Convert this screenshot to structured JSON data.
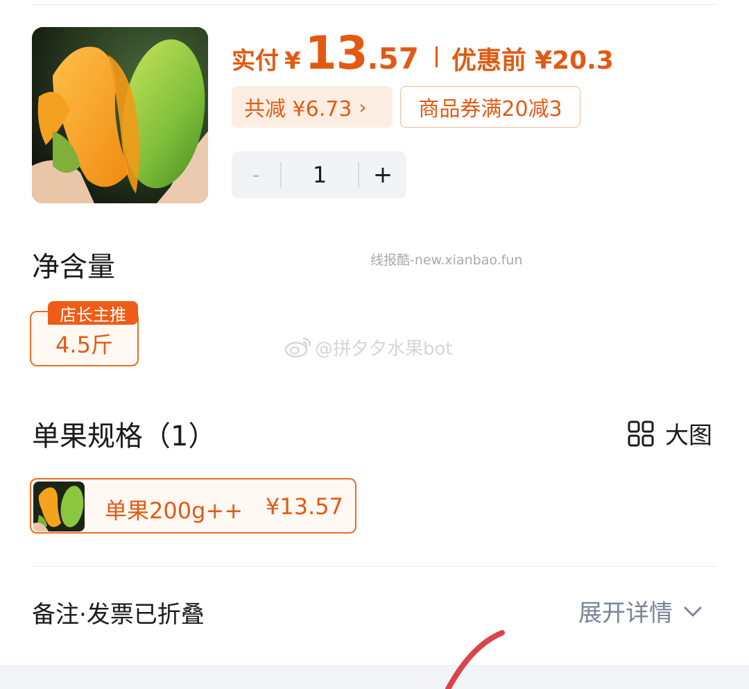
{
  "price": {
    "paid_label": "实付",
    "currency": "¥",
    "paid_int": "13",
    "paid_dec": ".57",
    "before_label": "优惠前",
    "before_value": "¥20.3",
    "accent_color": "#e25a12"
  },
  "chips": {
    "discount": "共减 ¥6.73",
    "discount_chevron": "›",
    "coupon": "商品券满20减3"
  },
  "stepper": {
    "minus": "-",
    "quantity": "1",
    "plus": "+"
  },
  "net_content": {
    "title": "净含量",
    "badge": "店长主推",
    "option": "4.5斤"
  },
  "spec": {
    "title": "单果规格（1）",
    "big_view_label": "大图",
    "big_view_icon": "grid-icon",
    "option_name": "单果200g++",
    "option_price": "¥13.57"
  },
  "watermarks": {
    "top": "线报酷-new.xianbao.fun",
    "mid": "@拼夕夕水果bot",
    "mid_icon": "weibo-icon"
  },
  "footer": {
    "remark": "备注·发票已折叠",
    "expand": "展开详情",
    "expand_icon": "chevron-down-icon"
  }
}
